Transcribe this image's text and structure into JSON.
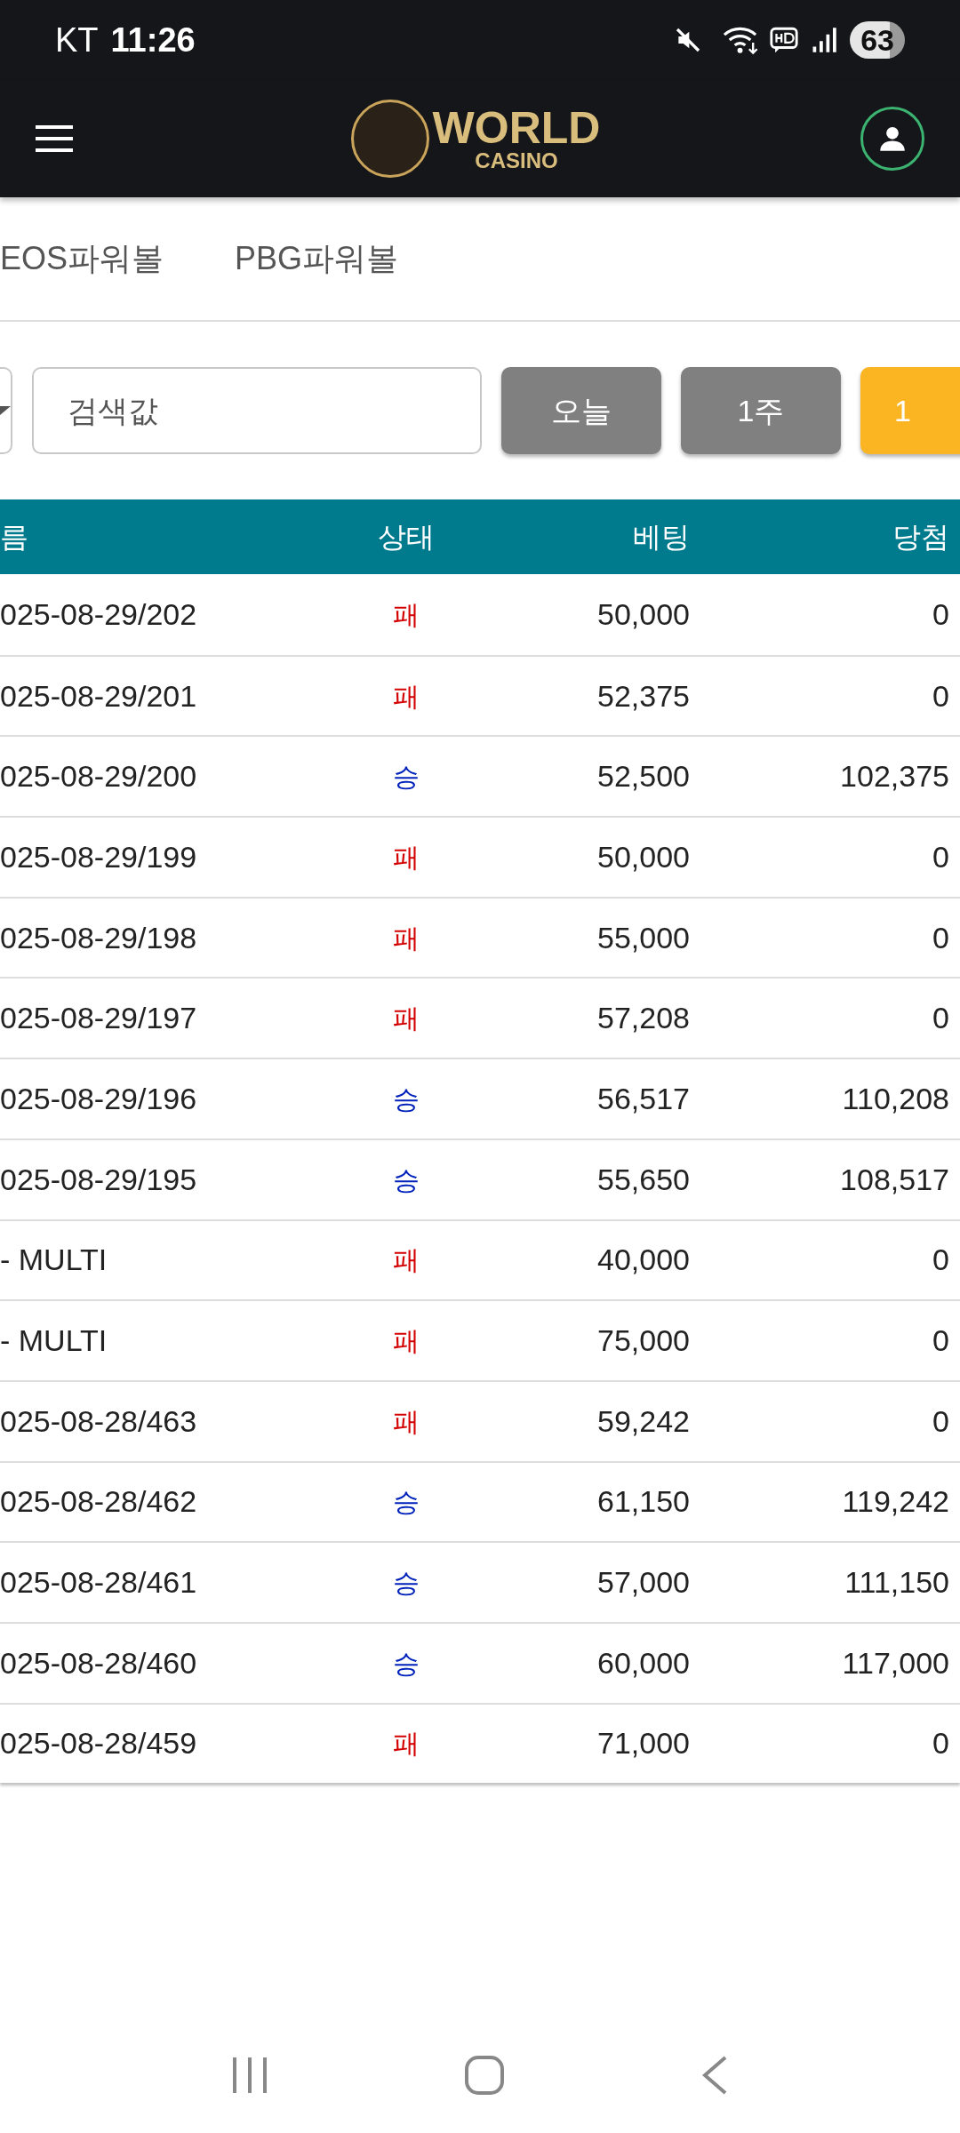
{
  "status_bar": {
    "carrier": "KT",
    "time": "11:26",
    "battery": "63"
  },
  "header": {
    "logo_title": "WORLD",
    "logo_subtitle": "CASINO"
  },
  "tabs": [
    {
      "label": "EOS파워볼",
      "selected": false
    },
    {
      "label": "PBG파워볼",
      "selected": false
    }
  ],
  "filter": {
    "search": {
      "placeholder": "검색값"
    },
    "buttons": [
      {
        "label": "오늘",
        "selected": false
      },
      {
        "label": "1주",
        "selected": false
      },
      {
        "label": "1",
        "selected": true
      }
    ]
  },
  "table": {
    "columns": [
      "름",
      "상태",
      "베팅",
      "당첨"
    ],
    "rows": [
      {
        "name": "025-08-29/202",
        "status": "패",
        "won": false,
        "bet": "50,000",
        "win": "0"
      },
      {
        "name": "025-08-29/201",
        "status": "패",
        "won": false,
        "bet": "52,375",
        "win": "0"
      },
      {
        "name": "025-08-29/200",
        "status": "승",
        "won": true,
        "bet": "52,500",
        "win": "102,375"
      },
      {
        "name": "025-08-29/199",
        "status": "패",
        "won": false,
        "bet": "50,000",
        "win": "0"
      },
      {
        "name": "025-08-29/198",
        "status": "패",
        "won": false,
        "bet": "55,000",
        "win": "0"
      },
      {
        "name": "025-08-29/197",
        "status": "패",
        "won": false,
        "bet": "57,208",
        "win": "0"
      },
      {
        "name": "025-08-29/196",
        "status": "승",
        "won": true,
        "bet": "56,517",
        "win": "110,208"
      },
      {
        "name": "025-08-29/195",
        "status": "승",
        "won": true,
        "bet": "55,650",
        "win": "108,517"
      },
      {
        "name": "- MULTI",
        "status": "패",
        "won": false,
        "bet": "40,000",
        "win": "0"
      },
      {
        "name": "- MULTI",
        "status": "패",
        "won": false,
        "bet": "75,000",
        "win": "0"
      },
      {
        "name": "025-08-28/463",
        "status": "패",
        "won": false,
        "bet": "59,242",
        "win": "0"
      },
      {
        "name": "025-08-28/462",
        "status": "승",
        "won": true,
        "bet": "61,150",
        "win": "119,242"
      },
      {
        "name": "025-08-28/461",
        "status": "승",
        "won": true,
        "bet": "57,000",
        "win": "111,150"
      },
      {
        "name": "025-08-28/460",
        "status": "승",
        "won": true,
        "bet": "60,000",
        "win": "117,000"
      },
      {
        "name": "025-08-28/459",
        "status": "패",
        "won": false,
        "bet": "71,000",
        "win": "0"
      }
    ]
  }
}
